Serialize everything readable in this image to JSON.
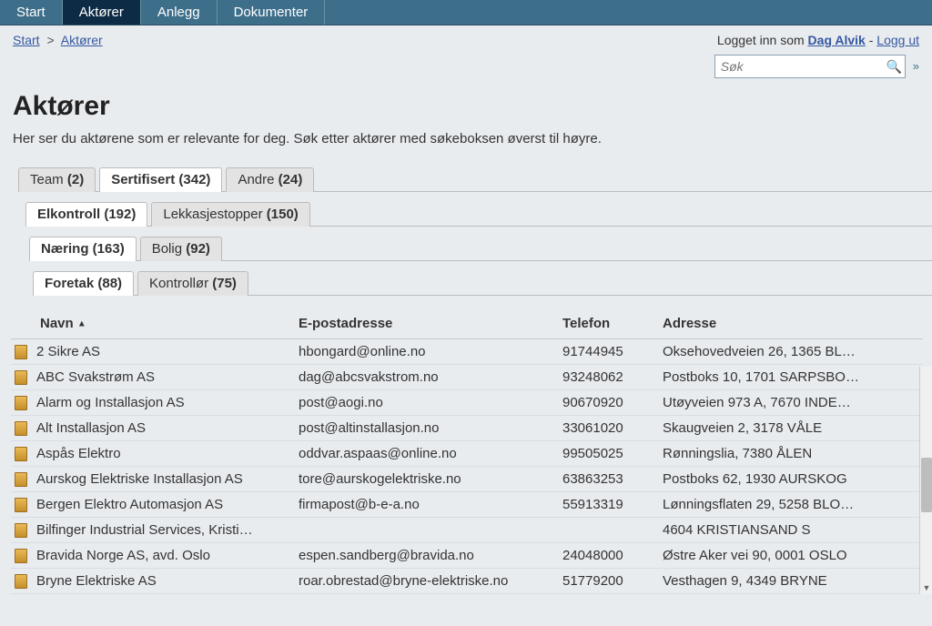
{
  "topnav": {
    "items": [
      {
        "label": "Start",
        "active": false
      },
      {
        "label": "Aktører",
        "active": true
      },
      {
        "label": "Anlegg",
        "active": false
      },
      {
        "label": "Dokumenter",
        "active": false
      }
    ]
  },
  "breadcrumb": {
    "start": "Start",
    "current": "Aktører"
  },
  "login": {
    "prefix": "Logget inn som ",
    "user": "Dag Alvik",
    "sep": " - ",
    "logout": "Logg ut"
  },
  "search": {
    "placeholder": "Søk"
  },
  "page": {
    "title": "Aktører",
    "description": "Her ser du aktørene som er relevante for deg. Søk etter aktører med søkeboksen øverst til høyre."
  },
  "tabs_level1": [
    {
      "label": "Team",
      "count": "(2)",
      "active": false
    },
    {
      "label": "Sertifisert",
      "count": "(342)",
      "active": true
    },
    {
      "label": "Andre",
      "count": "(24)",
      "active": false
    }
  ],
  "tabs_level2": [
    {
      "label": "Elkontroll",
      "count": "(192)",
      "active": true
    },
    {
      "label": "Lekkasjestopper",
      "count": "(150)",
      "active": false
    }
  ],
  "tabs_level3": [
    {
      "label": "Næring",
      "count": "(163)",
      "active": true
    },
    {
      "label": "Bolig",
      "count": "(92)",
      "active": false
    }
  ],
  "tabs_level4": [
    {
      "label": "Foretak",
      "count": "(88)",
      "active": true
    },
    {
      "label": "Kontrollør",
      "count": "(75)",
      "active": false
    }
  ],
  "table": {
    "columns": {
      "name": "Navn",
      "sort_indicator": "▲",
      "email": "E-postadresse",
      "phone": "Telefon",
      "address": "Adresse"
    },
    "rows": [
      {
        "name": "2 Sikre AS",
        "email": "hbongard@online.no",
        "phone": "91744945",
        "address": "Oksehovedveien 26, 1365 BL…"
      },
      {
        "name": "ABC Svakstrøm AS",
        "email": "dag@abcsvakstrom.no",
        "phone": "93248062",
        "address": "Postboks 10, 1701 SARPSBO…"
      },
      {
        "name": "Alarm og Installasjon AS",
        "email": "post@aogi.no",
        "phone": "90670920",
        "address": "Utøyveien 973 A, 7670 INDE…"
      },
      {
        "name": "Alt Installasjon AS",
        "email": "post@altinstallasjon.no",
        "phone": "33061020",
        "address": "Skaugveien 2, 3178 VÅLE"
      },
      {
        "name": "Aspås Elektro",
        "email": "oddvar.aspaas@online.no",
        "phone": "99505025",
        "address": "Rønningslia, 7380 ÅLEN"
      },
      {
        "name": "Aurskog Elektriske Installasjon AS",
        "email": "tore@aurskogelektriske.no",
        "phone": "63863253",
        "address": "Postboks 62, 1930 AURSKOG"
      },
      {
        "name": "Bergen Elektro Automasjon AS",
        "email": "firmapost@b-e-a.no",
        "phone": "55913319",
        "address": "Lønningsflaten 29, 5258 BLO…"
      },
      {
        "name": "Bilfinger Industrial Services, Kristi…",
        "email": "",
        "phone": "",
        "address": "4604 KRISTIANSAND S"
      },
      {
        "name": "Bravida Norge AS, avd. Oslo",
        "email": "espen.sandberg@bravida.no",
        "phone": "24048000",
        "address": "Østre Aker vei 90, 0001 OSLO"
      },
      {
        "name": "Bryne Elektriske AS",
        "email": "roar.obrestad@bryne-elektriske.no",
        "phone": "51779200",
        "address": "Vesthagen 9, 4349 BRYNE"
      }
    ]
  }
}
